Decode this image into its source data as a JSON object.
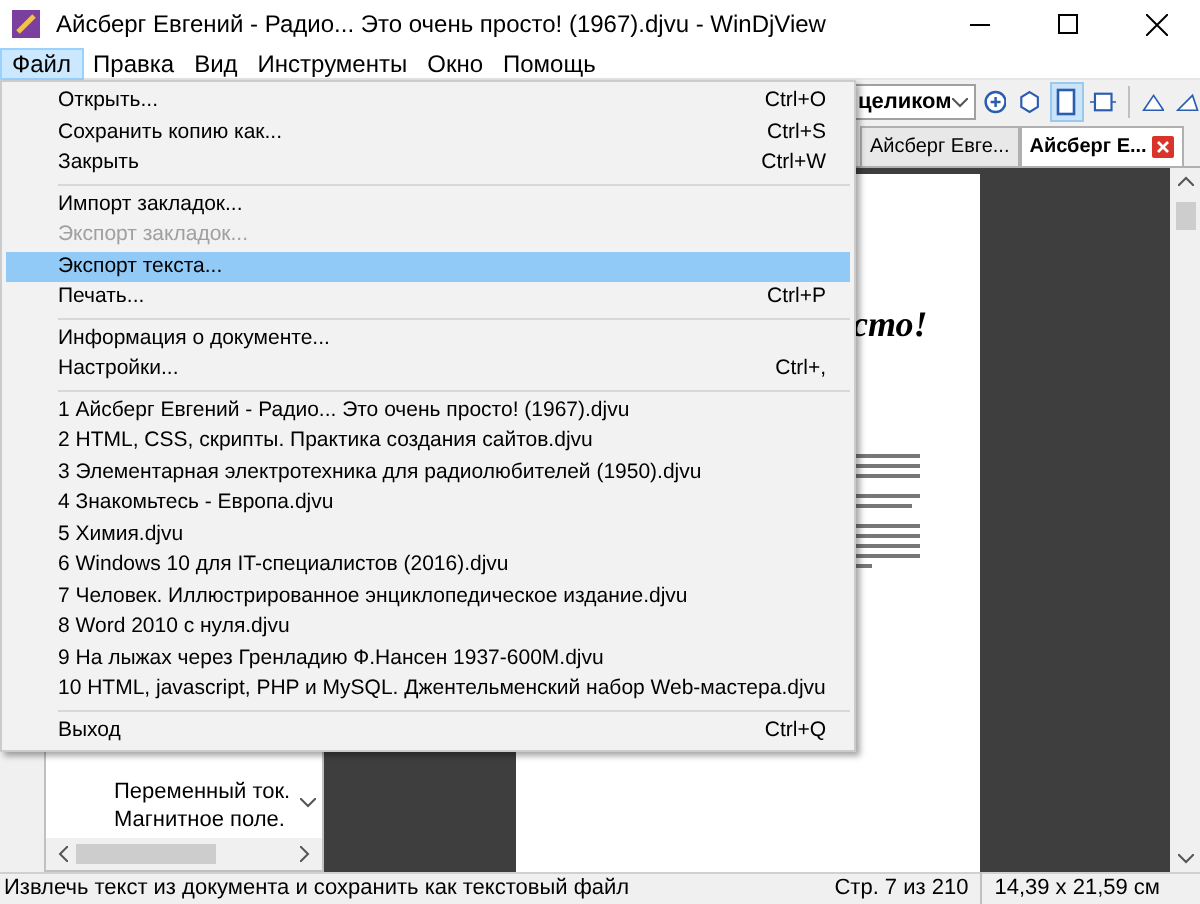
{
  "window": {
    "title": "Айсберг Евгений - Радио... Это очень просто! (1967).djvu - WinDjView"
  },
  "menubar": [
    {
      "label": "Файл",
      "selected": true
    },
    {
      "label": "Правка",
      "selected": false
    },
    {
      "label": "Вид",
      "selected": false
    },
    {
      "label": "Инструменты",
      "selected": false
    },
    {
      "label": "Окно",
      "selected": false
    },
    {
      "label": "Помощь",
      "selected": false
    }
  ],
  "toolbar": {
    "zoom_value": "целиком"
  },
  "tabs": [
    {
      "label": "Айсберг Евге...",
      "selected": false
    },
    {
      "label": "Айсберг Е...",
      "selected": true
    }
  ],
  "sidebar": {
    "items": [
      "Переменный ток.",
      "Магнитное поле."
    ]
  },
  "document": {
    "heading_fragment": "сто!"
  },
  "file_menu": [
    {
      "kind": "item",
      "label": "Открыть...",
      "shortcut": "Ctrl+O",
      "disabled": false,
      "selected": false
    },
    {
      "kind": "item",
      "label": "Сохранить копию как...",
      "shortcut": "Ctrl+S",
      "disabled": false,
      "selected": false
    },
    {
      "kind": "item",
      "label": "Закрыть",
      "shortcut": "Ctrl+W",
      "disabled": false,
      "selected": false
    },
    {
      "kind": "separator"
    },
    {
      "kind": "item",
      "label": "Импорт закладок...",
      "disabled": false,
      "selected": false
    },
    {
      "kind": "item",
      "label": "Экспорт закладок...",
      "disabled": true,
      "selected": false
    },
    {
      "kind": "item",
      "label": "Экспорт текста...",
      "disabled": false,
      "selected": true
    },
    {
      "kind": "item",
      "label": "Печать...",
      "shortcut": "Ctrl+P",
      "disabled": false,
      "selected": false
    },
    {
      "kind": "separator"
    },
    {
      "kind": "item",
      "label": "Информация о документе...",
      "disabled": false,
      "selected": false
    },
    {
      "kind": "item",
      "label": "Настройки...",
      "shortcut": "Ctrl+,",
      "disabled": false,
      "selected": false
    },
    {
      "kind": "separator"
    },
    {
      "kind": "item",
      "label": "1 Айсберг Евгений - Радио... Это очень просто! (1967).djvu",
      "disabled": false,
      "selected": false
    },
    {
      "kind": "item",
      "label": "2 HTML, CSS, скрипты. Практика создания сайтов.djvu",
      "disabled": false,
      "selected": false
    },
    {
      "kind": "item",
      "label": "3 Элементарная электротехника для радиолюбителей (1950).djvu",
      "disabled": false,
      "selected": false
    },
    {
      "kind": "item",
      "label": "4 Знакомьтесь - Европа.djvu",
      "disabled": false,
      "selected": false
    },
    {
      "kind": "item",
      "label": "5 Химия.djvu",
      "disabled": false,
      "selected": false
    },
    {
      "kind": "item",
      "label": "6 Windows 10 для IT-специалистов (2016).djvu",
      "disabled": false,
      "selected": false
    },
    {
      "kind": "item",
      "label": "7 Человек. Иллюстрированное энциклопедическое издание.djvu",
      "disabled": false,
      "selected": false
    },
    {
      "kind": "item",
      "label": "8 Word 2010 с нуля.djvu",
      "disabled": false,
      "selected": false
    },
    {
      "kind": "item",
      "label": "9 На лыжах через Гренладию Ф.Нансен 1937-600M.djvu",
      "disabled": false,
      "selected": false
    },
    {
      "kind": "item",
      "label": "10 HTML, javascript, PHP и MySQL. Джентельменский набор Web-мастера.djvu",
      "disabled": false,
      "selected": false
    },
    {
      "kind": "separator"
    },
    {
      "kind": "item",
      "label": "Выход",
      "shortcut": "Ctrl+Q",
      "disabled": false,
      "selected": false
    }
  ],
  "status_bar": {
    "message": "Извлечь текст из документа и сохранить как текстовый файл",
    "page": "Стр. 7 из 210",
    "size": "14,39 x 21,59 см"
  }
}
